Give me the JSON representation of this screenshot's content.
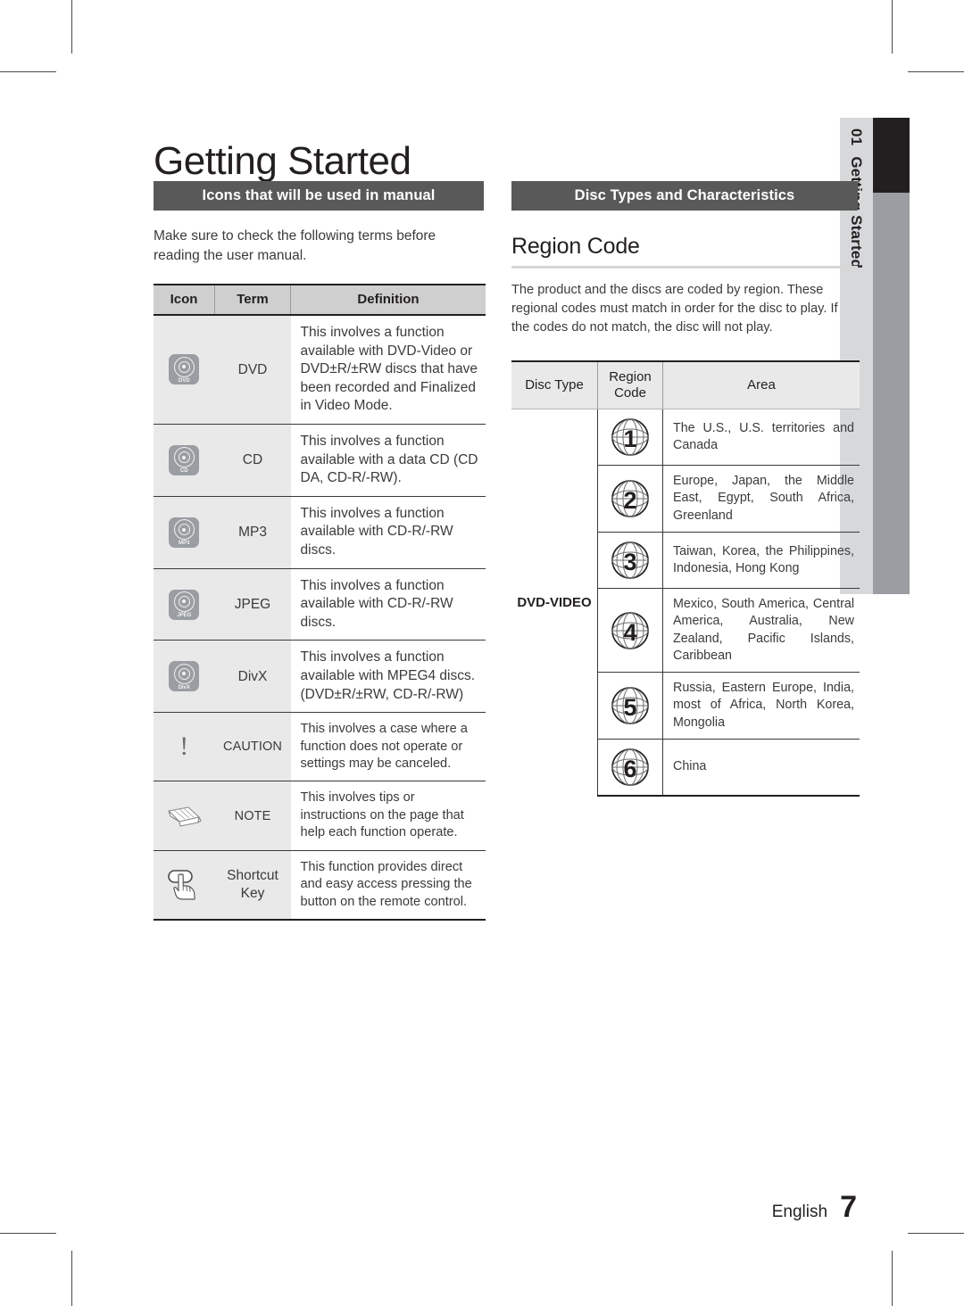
{
  "page": {
    "title": "Getting Started",
    "side_tab": {
      "number": "01",
      "label": "Getting Started"
    },
    "footer": {
      "language": "English",
      "page_number": "7"
    },
    "colors": {
      "section_bar_bg": "#595959",
      "section_bar_text": "#ffffff",
      "table_header_bg": "#cfcfcf",
      "cell_shade_bg": "#e9e9e9",
      "icon_badge_bg": "#9a9da1",
      "tab_light": "#d6d8da",
      "tab_dark": "#9a9da1",
      "tab_black": "#231f20",
      "rule": "#d7d7d7",
      "body_text": "#3b3b3b"
    }
  },
  "left_column": {
    "section_heading": "Icons that will be used in manual",
    "intro": "Make sure to check the following terms before reading the user manual.",
    "table": {
      "headers": [
        "Icon",
        "Term",
        "Definition"
      ],
      "rows": [
        {
          "icon": "disc-dvd-icon",
          "icon_label": "DVD",
          "term": "DVD",
          "definition": "This involves a function available with DVD-Video or DVD±R/±RW discs that have been recorded and Finalized in Video Mode."
        },
        {
          "icon": "disc-cd-icon",
          "icon_label": "CD",
          "term": "CD",
          "definition": "This involves a function available with a data CD (CD DA, CD-R/-RW)."
        },
        {
          "icon": "disc-mp3-icon",
          "icon_label": "MP3",
          "term": "MP3",
          "definition": "This involves a function available with CD-R/-RW discs."
        },
        {
          "icon": "disc-jpeg-icon",
          "icon_label": "JPEG",
          "term": "JPEG",
          "definition": "This involves a function available with CD-R/-RW discs."
        },
        {
          "icon": "disc-divx-icon",
          "icon_label": "DivX",
          "term": "DivX",
          "definition": "This involves a function available with MPEG4 discs. (DVD±R/±RW, CD-R/-RW)"
        },
        {
          "icon": "exclamation-caution-icon",
          "icon_label": "!",
          "term": "CAUTION",
          "definition": "This involves a case where a function does not operate or settings may be canceled."
        },
        {
          "icon": "pencil-note-icon",
          "icon_label": "",
          "term": "NOTE",
          "definition": "This involves tips or instructions on the page that help each function operate."
        },
        {
          "icon": "hand-pressing-button-icon",
          "icon_label": "",
          "term": "Shortcut Key",
          "definition": "This function provides direct and easy access pressing the button on the remote control."
        }
      ]
    }
  },
  "right_column": {
    "section_heading": "Disc Types and Characteristics",
    "sub_title": "Region Code",
    "body_text": "The product and the discs are coded by region. These regional codes must match in order for the disc to play. If the codes do not match, the disc will not play.",
    "table": {
      "headers": [
        "Disc Type",
        "Region Code",
        "Area"
      ],
      "disc_type": "DVD-VIDEO",
      "rows": [
        {
          "code": "1",
          "area": "The U.S., U.S. territories and Canada"
        },
        {
          "code": "2",
          "area": "Europe, Japan, the Middle East, Egypt, South Africa, Greenland"
        },
        {
          "code": "3",
          "area": "Taiwan, Korea, the Philippines, Indonesia, Hong Kong"
        },
        {
          "code": "4",
          "area": "Mexico, South America, Central America, Australia, New Zealand, Pacific Islands, Caribbean"
        },
        {
          "code": "5",
          "area": "Russia, Eastern Europe, India, most of Africa, North Korea, Mongolia"
        },
        {
          "code": "6",
          "area": "China"
        }
      ]
    }
  }
}
